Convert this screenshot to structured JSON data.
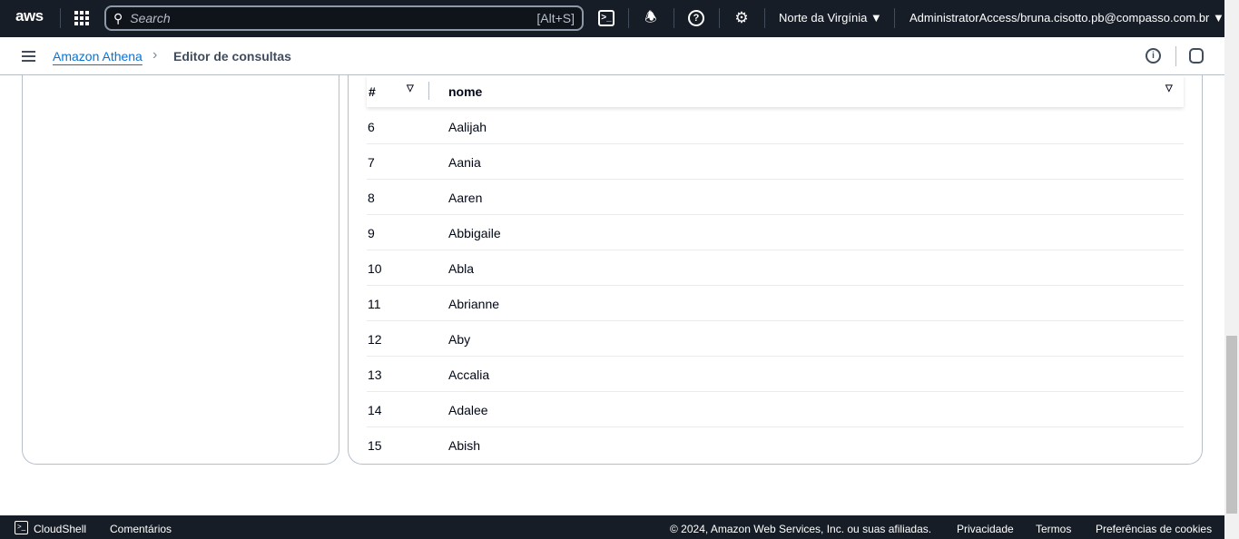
{
  "topbar": {
    "logo": "aws",
    "search_placeholder": "Search",
    "search_shortcut": "[Alt+S]",
    "region": "Norte da Virgínia ▼",
    "account": "AdministratorAccess/bruna.cisotto.pb@compasso.com.br ▼"
  },
  "breadcrumb": {
    "parent": "Amazon Athena",
    "current": "Editor de consultas"
  },
  "table": {
    "columns": [
      "#",
      "nome"
    ],
    "rows": [
      [
        "6",
        "Aalijah"
      ],
      [
        "7",
        "Aania"
      ],
      [
        "8",
        "Aaren"
      ],
      [
        "9",
        "Abbigaile"
      ],
      [
        "10",
        "Abla"
      ],
      [
        "11",
        "Abrianne"
      ],
      [
        "12",
        "Aby"
      ],
      [
        "13",
        "Accalia"
      ],
      [
        "14",
        "Adalee"
      ],
      [
        "15",
        "Abish"
      ]
    ]
  },
  "footer": {
    "cloudshell": "CloudShell",
    "feedback": "Comentários",
    "copyright": "© 2024, Amazon Web Services, Inc. ou suas afiliadas.",
    "privacy": "Privacidade",
    "terms": "Termos",
    "cookies": "Preferências de cookies"
  }
}
